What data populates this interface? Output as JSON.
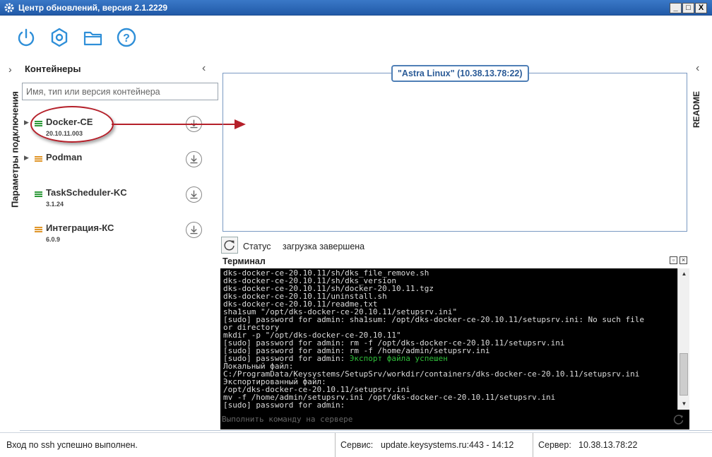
{
  "window": {
    "title": "Центр обновлений, версия 2.1.2229",
    "minimize": "_",
    "maximize": "□",
    "close": "X"
  },
  "toolbar": {
    "icons": [
      "power-icon",
      "settings-hexagon-icon",
      "folder-icon",
      "help-icon"
    ],
    "help_glyph": "?"
  },
  "left_rail": {
    "label": "Параметры подключения",
    "chevron": "›"
  },
  "containers": {
    "title": "Контейнеры",
    "collapse": "‹",
    "search_placeholder": "Имя, тип или версия контейнера",
    "items": [
      {
        "name": "Docker-CE",
        "version": "20.10.11.003",
        "status_color": "#2e9a3a",
        "expandable": true
      },
      {
        "name": "Podman",
        "version": "",
        "status_color": "#e0962a",
        "expandable": true
      },
      {
        "name": "TaskScheduler-KC",
        "version": "3.1.24",
        "status_color": "#2e9a3a",
        "expandable": false
      },
      {
        "name": "Интеграция-КС",
        "version": "6.0.9",
        "status_color": "#e0962a",
        "expandable": false
      }
    ]
  },
  "host": {
    "label": "\"Astra Linux\" (10.38.13.78:22)"
  },
  "readme": {
    "label": "README",
    "chevron": "‹"
  },
  "status": {
    "label": "Статус",
    "value": "загрузка завершена"
  },
  "terminal": {
    "title": "Терминал",
    "restore": "▫",
    "close": "×",
    "lines": [
      "dks-docker-ce-20.10.11/sh/dks_file_remove.sh",
      "dks-docker-ce-20.10.11/sh/dks_version",
      "dks-docker-ce-20.10.11/sh/docker-20.10.11.tgz",
      "dks-docker-ce-20.10.11/uninstall.sh",
      "dks-docker-ce-20.10.11/readme.txt",
      "sha1sum \"/opt/dks-docker-ce-20.10.11/setupsrv.ini\"",
      "[sudo] password for admin: sha1sum: /opt/dks-docker-ce-20.10.11/setupsrv.ini: No such file",
      "or directory",
      "mkdir -p \"/opt/dks-docker-ce-20.10.11\"",
      "[sudo] password for admin: rm -f /opt/dks-docker-ce-20.10.11/setupsrv.ini",
      "[sudo] password for admin: rm -f /home/admin/setupsrv.ini",
      "[sudo] password for admin: ",
      "Локальный файл:",
      "C:/ProgramData/Keysystems/SetupSrv/workdir/containers/dks-docker-ce-20.10.11/setupsrv.ini",
      "Экспортированный файл:",
      "/opt/dks-docker-ce-20.10.11/setupsrv.ini",
      "mv -f /home/admin/setupsrv.ini /opt/dks-docker-ce-20.10.11/setupsrv.ini",
      "[sudo] password for admin:"
    ],
    "success_line_index": 11,
    "success_text": "Экспорт файла успешен",
    "command_placeholder": "Выполнить команду на сервере"
  },
  "statusbar": {
    "message": "Вход по ssh успешно выполнен.",
    "service_label": "Сервис:",
    "service_value": "update.keysystems.ru:443 - 14:12",
    "server_label": "Сервер:",
    "server_value": "10.38.13.78:22"
  },
  "colors": {
    "accent": "#2f8fd8",
    "title_bar": "#215aa8",
    "highlight": "#b5202a"
  }
}
